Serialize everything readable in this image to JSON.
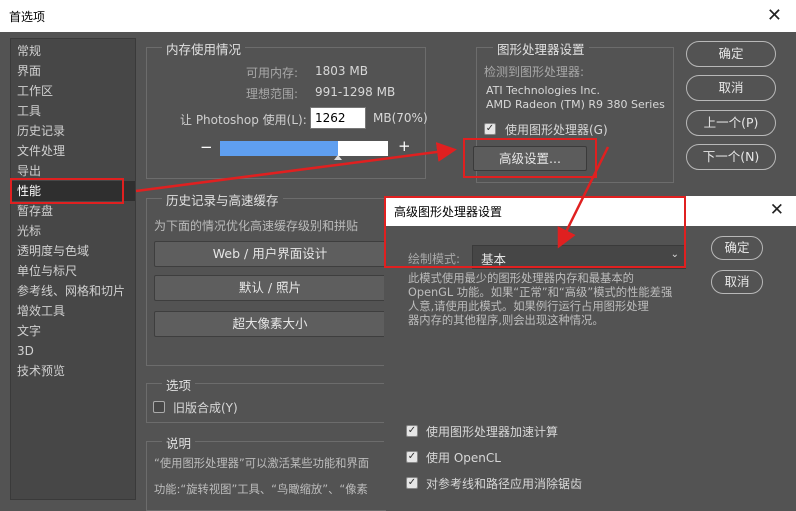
{
  "window": {
    "title": "首选项",
    "close": "✕"
  },
  "sidebar": {
    "items": [
      "常规",
      "界面",
      "工作区",
      "工具",
      "历史记录",
      "文件处理",
      "导出",
      "性能",
      "暂存盘",
      "光标",
      "透明度与色域",
      "单位与标尺",
      "参考线、网格和切片",
      "增效工具",
      "文字",
      "3D",
      "技术预览"
    ],
    "selected_index": 7
  },
  "memory": {
    "legend": "内存使用情况",
    "available_label": "可用内存:",
    "available_value": "1803 MB",
    "ideal_label": "理想范围:",
    "ideal_value": "991-1298 MB",
    "let_label": "让 Photoshop 使用(L):",
    "use_value": "1262",
    "use_unit": "MB(70%)",
    "minus": "−",
    "plus": "+",
    "slider_percent": 70
  },
  "gpu": {
    "legend": "图形处理器设置",
    "detected_label": "检测到图形处理器:",
    "vendor": "ATI Technologies Inc.",
    "model": "AMD Radeon (TM) R9 380 Series",
    "use_gpu_label": "使用图形处理器(G)",
    "use_gpu_checked": true,
    "advanced_button": "高级设置..."
  },
  "buttons": {
    "ok": "确定",
    "cancel": "取消",
    "prev": "上一个(P)",
    "next": "下一个(N)"
  },
  "history": {
    "legend": "历史记录与高速缓存",
    "desc": "为下面的情况优化高速缓存级别和拼贴",
    "btn_web": "Web / 用户界面设计",
    "btn_default": "默认 / 照片",
    "btn_huge": "超大像素大小"
  },
  "options": {
    "legend": "选项",
    "legacy_label": "旧版合成(Y)",
    "legacy_checked": false
  },
  "notes": {
    "legend": "说明",
    "line1": "“使用图形处理器”可以激活某些功能和界面",
    "line2": "功能:“旋转视图”工具、“鸟瞰缩放”、“像素"
  },
  "advanced_dialog": {
    "title": "高级图形处理器设置",
    "close": "✕",
    "mode_label": "绘制模式:",
    "mode_value": "基本",
    "ok": "确定",
    "cancel": "取消",
    "desc_lines": [
      "此模式使用最少的图形处理器内存和最基本的",
      "OpenGL 功能。如果“正常”和“高级”模式的性能差强",
      "人意,请使用此模式。如果例行运行占用图形处理",
      "器内存的其他程序,则会出现这种情况。"
    ],
    "check_compute": "使用图形处理器加速计算",
    "check_opencl": "使用 OpenCL",
    "check_antialias": "对参考线和路径应用消除锯齿"
  },
  "colors": {
    "annotation_red": "#e02020",
    "slider_blue": "#5f9ff0",
    "panel_bg": "#535353"
  }
}
